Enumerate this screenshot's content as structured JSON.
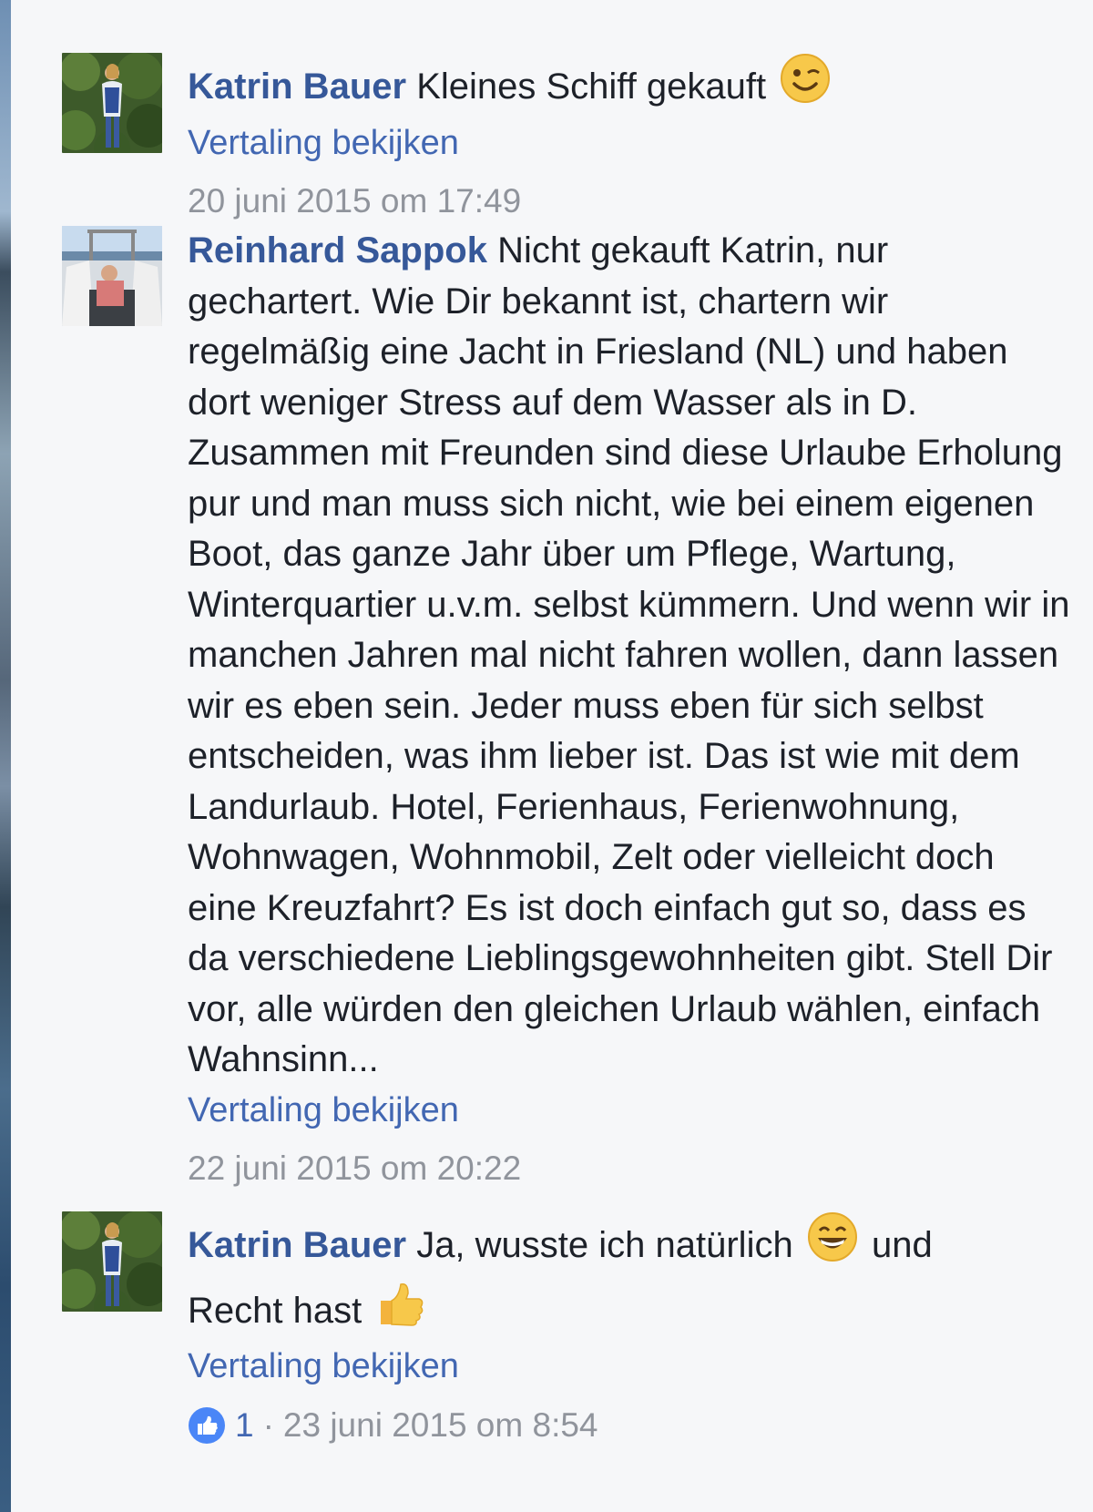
{
  "comments": [
    {
      "author": "Katrin Bauer",
      "text": "Kleines Schiff gekauft",
      "translate": "Vertaling bekijken",
      "timestamp": "20 juni 2015 om 17:49",
      "avatar": "woman-in-garden-avatar",
      "emoji": "wink-emoji"
    },
    {
      "author": "Reinhard Sappok",
      "text": "Nicht gekauft Katrin, nur gechartert. Wie Dir bekannt ist, chartern wir regelmäßig eine Jacht in Friesland (NL) und haben dort weniger Stress auf dem Wasser als in D. Zusammen mit Freunden sind diese Urlaube Erholung pur und man muss sich nicht, wie bei einem eigenen Boot, das ganze Jahr über um Pflege, Wartung, Winterquartier u.v.m. selbst kümmern. Und wenn wir in manchen Jahren mal nicht fahren wollen, dann lassen wir es eben sein. Jeder muss eben für sich selbst entscheiden, was ihm lieber ist. Das ist wie mit dem Landurlaub. Hotel, Ferienhaus, Ferienwohnung, Wohnwagen, Wohnmobil, Zelt oder vielleicht doch eine Kreuzfahrt? Es ist doch einfach gut so, dass es da verschiedene Lieblingsgewohnheiten gibt. Stell Dir vor, alle würden den gleichen Urlaub wählen, einfach Wahnsinn...",
      "translate": "Vertaling bekijken",
      "timestamp": "22 juni 2015 om 20:22",
      "avatar": "man-on-boat-avatar"
    },
    {
      "author": "Katrin Bauer",
      "text_part1": "Ja, wusste ich natürlich",
      "text_part2": "und",
      "text_part3": "Recht hast",
      "translate": "Vertaling bekijken",
      "like_count": "1",
      "separator": "·",
      "timestamp": "23 juni 2015 om 8:54",
      "avatar": "woman-in-garden-avatar",
      "emoji1": "grin-emoji",
      "emoji2": "thumbs-up-emoji"
    }
  ],
  "colors": {
    "author": "#365899",
    "link": "#4267b2",
    "text": "#1d2129",
    "meta": "#90949c",
    "background": "#f6f7f9"
  }
}
